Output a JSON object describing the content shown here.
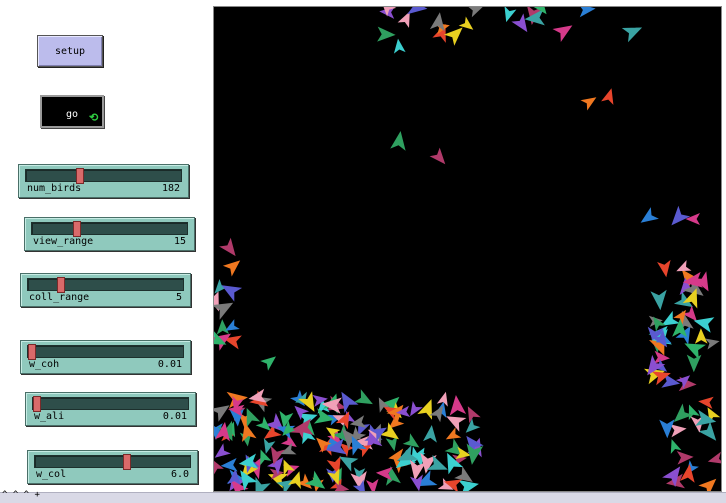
{
  "buttons": {
    "setup": "setup",
    "go": "go",
    "go_forever_icon": "forever-arrows-icon"
  },
  "sliders": [
    {
      "name": "num_birds",
      "value": "182",
      "fraction": 0.34
    },
    {
      "name": "view_range",
      "value": "15",
      "fraction": 0.28
    },
    {
      "name": "coll_range",
      "value": "5",
      "fraction": 0.2
    },
    {
      "name": "w_coh",
      "value": "0.01",
      "fraction": 0.0
    },
    {
      "name": "w_ali",
      "value": "0.01",
      "fraction": 0.0
    },
    {
      "name": "w_col",
      "value": "6.0",
      "fraction": 0.6
    }
  ],
  "colors": {
    "button_bg": "#bcbcec",
    "slider_bg": "#8fc9bd",
    "slider_thumb": "#d96a6a",
    "view_bg": "#000000"
  },
  "bottom_bar": {
    "arrows": "^ ^ ^ +"
  }
}
